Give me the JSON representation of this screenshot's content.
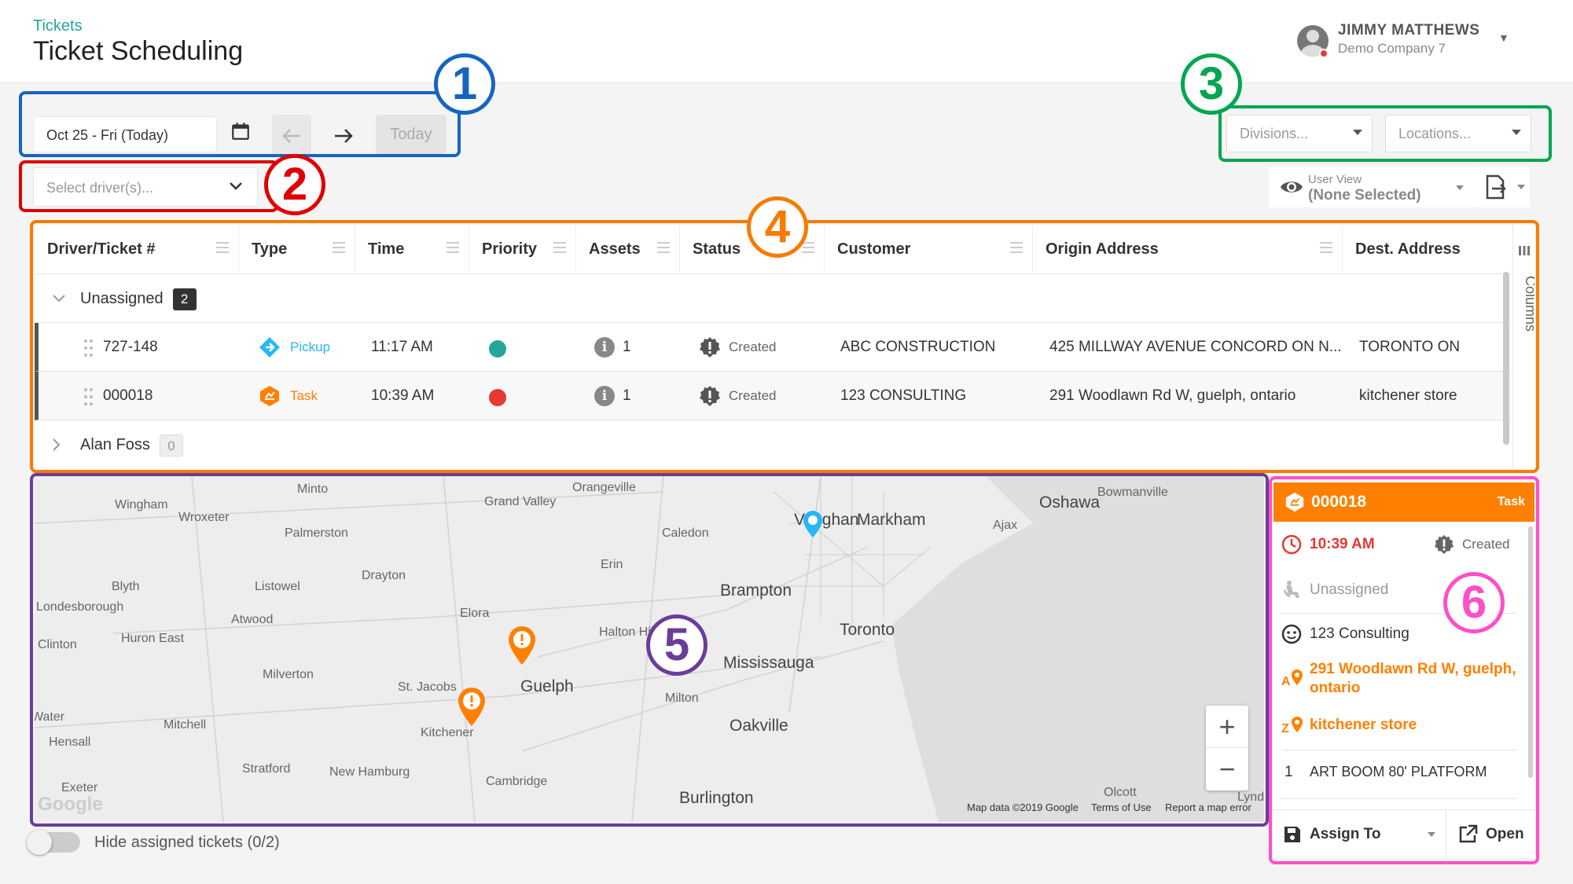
{
  "header": {
    "breadcrumb": "Tickets",
    "title": "Ticket Scheduling",
    "user_name": "JIMMY MATTHEWS",
    "company": "Demo Company 7"
  },
  "toolbar": {
    "date": "Oct 25 - Fri (Today)",
    "today_label": "Today",
    "driver_placeholder": "Select driver(s)...",
    "divisions_placeholder": "Divisions...",
    "locations_placeholder": "Locations...",
    "user_view_label": "User View",
    "user_view_value": "(None Selected)"
  },
  "annotations": [
    "1",
    "2",
    "3",
    "4",
    "5",
    "6"
  ],
  "grid": {
    "columns": [
      "Driver/Ticket #",
      "Type",
      "Time",
      "Priority",
      "Assets",
      "Status",
      "Customer",
      "Origin Address",
      "Dest. Address"
    ],
    "columns_tab": "Columns",
    "groups": [
      {
        "name": "Unassigned",
        "count": "2"
      },
      {
        "name": "Alan Foss",
        "count": "0"
      }
    ],
    "rows": [
      {
        "ticket": "727-148",
        "type": "Pickup",
        "type_color": "#29b6f6",
        "time": "11:17 AM",
        "priority_color": "#26a69a",
        "assets": "1",
        "status": "Created",
        "customer": "ABC CONSTRUCTION",
        "origin": "425 MILLWAY AVENUE CONCORD ON N...",
        "dest": "TORONTO ON"
      },
      {
        "ticket": "000018",
        "type": "Task",
        "type_color": "#ff8000",
        "time": "10:39 AM",
        "priority_color": "#e53935",
        "assets": "1",
        "status": "Created",
        "customer": "123 CONSULTING",
        "origin": "291 Woodlawn Rd W, guelph, ontario",
        "dest": "kitchener store"
      }
    ]
  },
  "map": {
    "labels": [
      "Minto",
      "Wingham",
      "Wroxeter",
      "Grand Valley",
      "Orangeville",
      "Bowmanville",
      "Oshawa",
      "Vaughan",
      "Markham",
      "Ajax",
      "Palmerston",
      "Caledon",
      "Drayton",
      "Blyth",
      "Listowel",
      "Londesborough",
      "Erin",
      "Brampton",
      "Atwood",
      "Elora",
      "Halton Hills",
      "Huron East",
      "Clinton",
      "Toronto",
      "Mississauga",
      "Milverton",
      "St. Jacobs",
      "Guelph",
      "Milton",
      "Water",
      "Mitchell",
      "Kitchener",
      "Oakville",
      "Hensall",
      "Stratford",
      "New Hamburg",
      "Cambridge",
      "Exeter",
      "Burlington",
      "Olcott",
      "Lyndon"
    ],
    "copyright": "Map data ©2019 Google",
    "terms": "Terms of Use",
    "report": "Report a map error",
    "google": "Google",
    "zoom_in": "+",
    "zoom_out": "−"
  },
  "panel": {
    "ticket": "000018",
    "kind": "Task",
    "time": "10:39 AM",
    "status": "Created",
    "driver": "Unassigned",
    "customer": "123 Consulting",
    "origin_line1": "291 Woodlawn Rd W, guelph,",
    "origin_line2": "ontario",
    "dest": "kitchener store",
    "asset_qty": "1",
    "asset_name": "ART BOOM 80' PLATFORM",
    "assign_label": "Assign To",
    "open_label": "Open",
    "accent": "#ff8000"
  },
  "footer": {
    "hide_assigned": "Hide assigned tickets (0/2)"
  },
  "colors": {
    "ann1": "#1565c0",
    "ann2": "#e00000",
    "ann3": "#00a651",
    "ann4": "#f57c00",
    "ann5": "#6a3d9a",
    "ann6": "#ff4fc7"
  }
}
